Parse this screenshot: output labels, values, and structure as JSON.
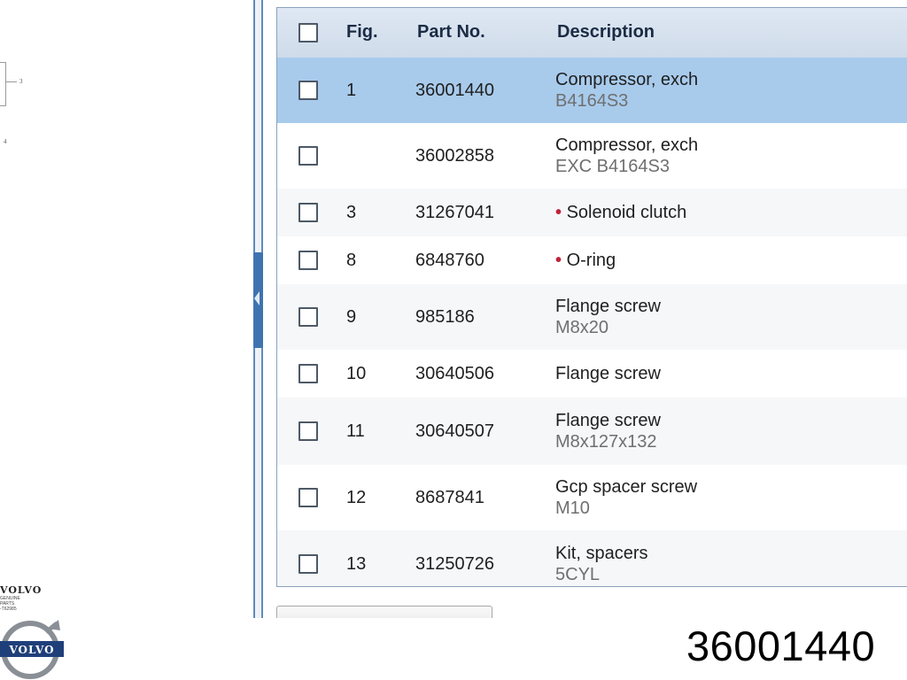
{
  "diagram": {
    "callouts": [
      "3",
      "4"
    ]
  },
  "table": {
    "headers": {
      "fig": "Fig.",
      "part_no": "Part No.",
      "description": "Description"
    },
    "rows": [
      {
        "fig": "1",
        "part_no": "36001440",
        "description": "Compressor, exch",
        "sub": "B4164S3",
        "bullet": "",
        "selected": true
      },
      {
        "fig": "",
        "part_no": "36002858",
        "description": "Compressor, exch",
        "sub": "EXC B4164S3",
        "bullet": "",
        "selected": false
      },
      {
        "fig": "3",
        "part_no": "31267041",
        "description": "Solenoid clutch",
        "sub": "",
        "bullet": "•",
        "selected": false
      },
      {
        "fig": "8",
        "part_no": "6848760",
        "description": "O-ring",
        "sub": "",
        "bullet": "•",
        "selected": false
      },
      {
        "fig": "9",
        "part_no": "985186",
        "description": "Flange screw",
        "sub": "M8x20",
        "bullet": "",
        "selected": false
      },
      {
        "fig": "10",
        "part_no": "30640506",
        "description": "Flange screw",
        "sub": "",
        "bullet": "",
        "selected": false
      },
      {
        "fig": "11",
        "part_no": "30640507",
        "description": "Flange screw",
        "sub": "M8x127x132",
        "bullet": "",
        "selected": false
      },
      {
        "fig": "12",
        "part_no": "8687841",
        "description": "Gcp spacer screw",
        "sub": "M10",
        "bullet": "",
        "selected": false
      },
      {
        "fig": "13",
        "part_no": "31250726",
        "description": "Kit, spacers",
        "sub": "5CYL",
        "bullet": "",
        "selected": false
      }
    ]
  },
  "branding": {
    "small_word": "VOLVO",
    "small_line1": "GENUINE PARTS",
    "small_line2": "-T62985",
    "emblem_word": "VOLVO"
  },
  "overlay_part_number": "36001440",
  "colors": {
    "selected_row": "#a8cbec",
    "header_bg": "#dfe8f3",
    "splitter": "#3f73b0",
    "bullet": "#c0223a",
    "volvo_blue": "#1f3f7a"
  }
}
